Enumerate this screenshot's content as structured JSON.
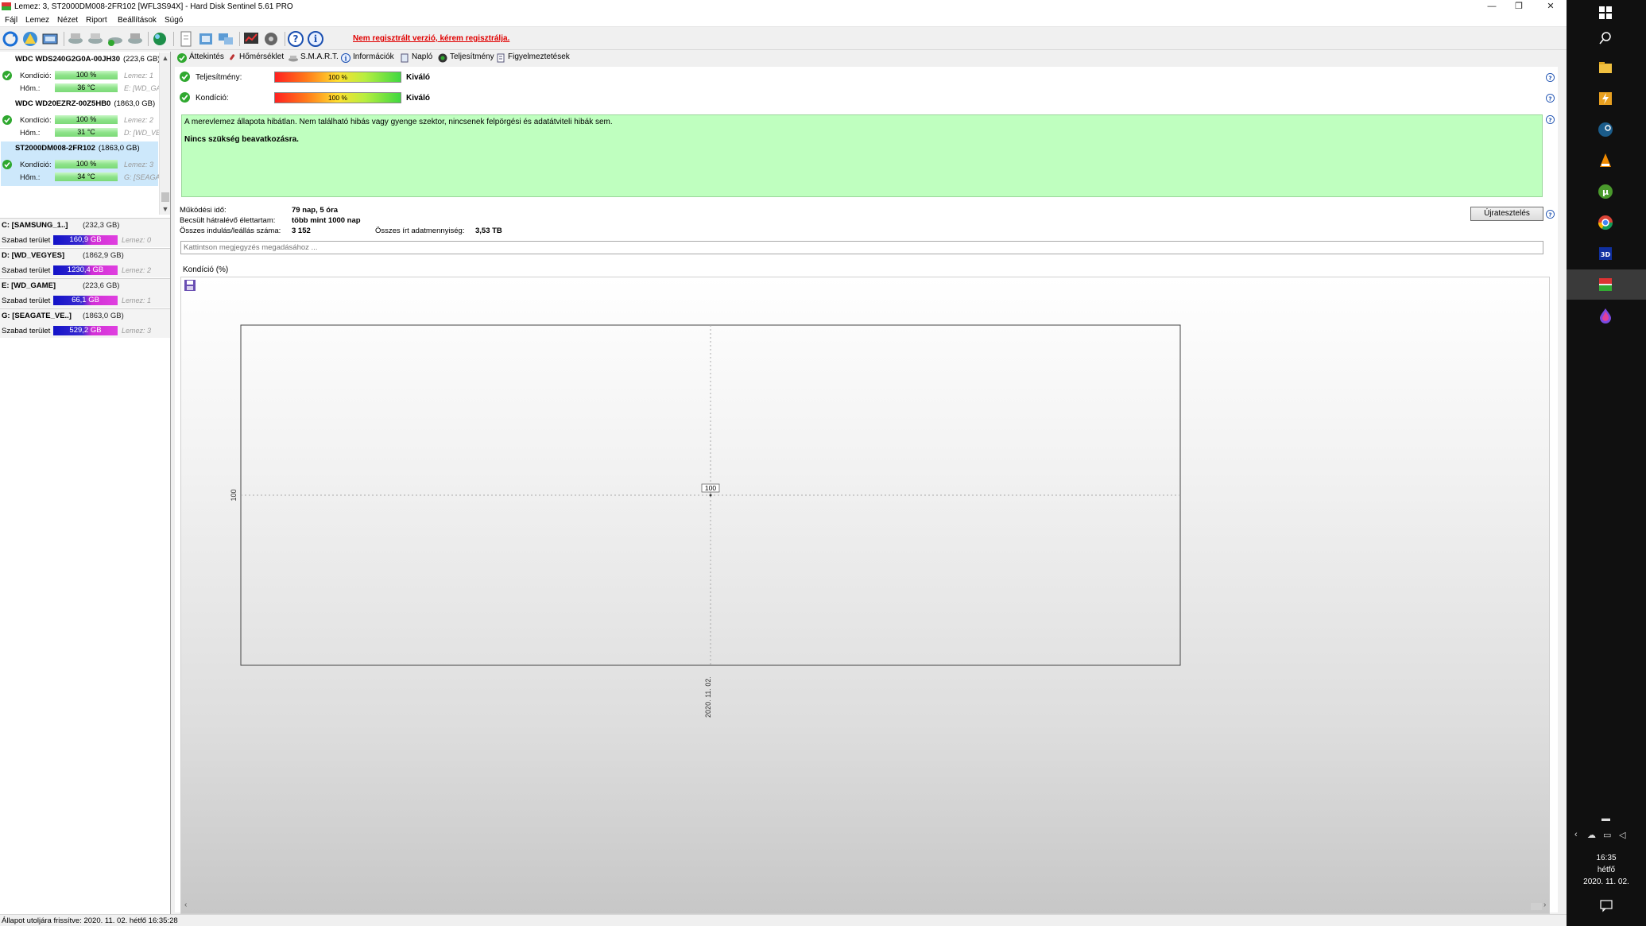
{
  "window": {
    "title": "Lemez: 3, ST2000DM008-2FR102 [WFL3S94X]  -  Hard Disk Sentinel 5.61 PRO",
    "controls": {
      "minimize": "—",
      "restore": "❐",
      "close": "✕"
    }
  },
  "menu": [
    "Fájl",
    "Lemez",
    "Nézet",
    "Riport",
    "Beállítások",
    "Súgó"
  ],
  "toolbar": {
    "registration_warning": "Nem regisztrált verzió, kérem regisztrálja."
  },
  "disks": [
    {
      "name": "WDC WDS240G2G0A-00JH30",
      "size": "(223,6 GB)",
      "health_label": "Kondíció:",
      "health": "100 %",
      "temp_label": "Hőm.:",
      "temp": "36 °C",
      "disk_info": "Lemez: 1",
      "volume_info": "E: [WD_GA"
    },
    {
      "name": "WDC WD20EZRZ-00Z5HB0",
      "size": "(1863,0 GB)",
      "health_label": "Kondíció:",
      "health": "100 %",
      "temp_label": "Hőm.:",
      "temp": "31 °C",
      "disk_info": "Lemez: 2",
      "volume_info": "D: [WD_VE"
    },
    {
      "name": "ST2000DM008-2FR102",
      "size": "(1863,0 GB)",
      "health_label": "Kondíció:",
      "health": "100 %",
      "temp_label": "Hőm.:",
      "temp": "34 °C",
      "disk_info": "Lemez: 3",
      "volume_info": "G: [SEAGA"
    }
  ],
  "volumes": [
    {
      "name": "C: [SAMSUNG_1..]",
      "size": "(232,3 GB)",
      "free_label": "Szabad terület",
      "free": "160,9 GB",
      "disk_info": "Lemez: 0"
    },
    {
      "name": "D: [WD_VEGYES]",
      "size": "(1862,9 GB)",
      "free_label": "Szabad terület",
      "free": "1230,4 GB",
      "disk_info": "Lemez: 2"
    },
    {
      "name": "E: [WD_GAME]",
      "size": "(223,6 GB)",
      "free_label": "Szabad terület",
      "free": "66,1 GB",
      "disk_info": "Lemez: 1"
    },
    {
      "name": "G: [SEAGATE_VE..]",
      "size": "(1863,0 GB)",
      "free_label": "Szabad terület",
      "free": "529,2 GB",
      "disk_info": "Lemez: 3"
    }
  ],
  "tabs": [
    "Áttekintés",
    "Hőmérséklet",
    "S.M.A.R.T.",
    "Információk",
    "Napló",
    "Teljesítmény",
    "Figyelmeztetések"
  ],
  "overview": {
    "performance": {
      "label": "Teljesítmény:",
      "value": "100 %",
      "rating": "Kiváló"
    },
    "health": {
      "label": "Kondíció:",
      "value": "100 %",
      "rating": "Kiváló"
    },
    "status_line1": "A merevlemez állapota hibátlan. Nem található hibás vagy gyenge szektor, nincsenek felpörgési és adatátviteli hibák sem.",
    "status_line2": "Nincs szükség beavatkozásra.",
    "stats": {
      "uptime_label": "Működési idő:",
      "uptime": "79 nap, 5 óra",
      "remaining_label": "Becsült hátralévő élettartam:",
      "remaining": "több mint 1000 nap",
      "starts_label": "Összes indulás/leállás száma:",
      "starts": "3 152",
      "written_label": "Összes írt adatmennyiség:",
      "written": "3,53 TB"
    },
    "retest_button": "Újratesztelés",
    "note_placeholder": "Kattintson megjegyzés megadásához ...",
    "chart_title": "Kondíció  (%)"
  },
  "chart_data": {
    "type": "line",
    "title": "Kondíció  (%)",
    "x": [
      "2020. 11. 02."
    ],
    "series": [
      {
        "values": [
          100
        ]
      }
    ],
    "ytick_labels": [
      "100"
    ],
    "point_labels": [
      "100"
    ],
    "grid": true
  },
  "statusbar": {
    "text": "Állapot utoljára frissítve: 2020. 11. 02. hétfő 16:35:28"
  },
  "taskbar": {
    "clock_time": "16:35",
    "clock_day": "hétfő",
    "clock_date": "2020. 11. 02."
  },
  "colors": {
    "ok_green": "#2fa82f",
    "status_bg": "#bfffbf",
    "warning_red": "#e00000",
    "selected_disk": "#cde8fb"
  }
}
